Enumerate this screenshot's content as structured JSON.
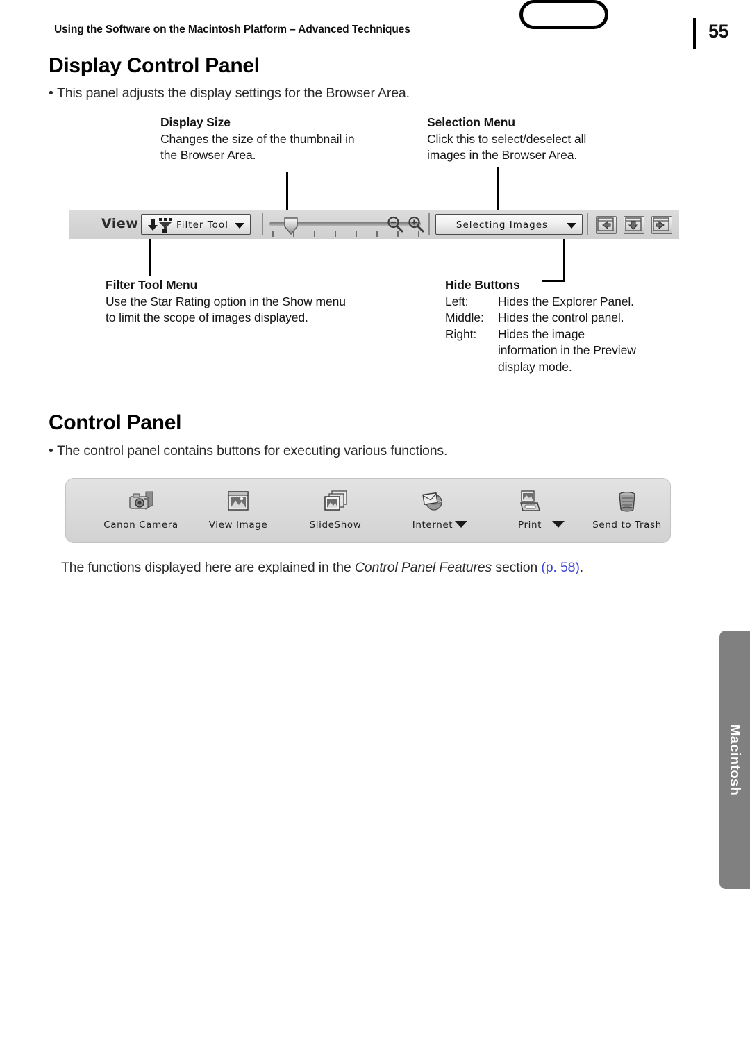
{
  "header": {
    "running_head": "Using the Software on the Macintosh Platform – Advanced Techniques",
    "page_number": "55"
  },
  "sections": [
    {
      "heading": "Display Control Panel",
      "bullet": "This panel adjusts the display settings for the Browser Area."
    },
    {
      "heading": "Control Panel",
      "bullet": "The control panel contains buttons for executing various functions."
    }
  ],
  "callouts": {
    "display_size": {
      "title": "Display Size",
      "lines": [
        "Changes the size of the thumbnail in",
        "the Browser Area."
      ]
    },
    "selection_menu": {
      "title": "Selection Menu",
      "lines": [
        "Click this to select/deselect all",
        "images in the Browser Area."
      ]
    },
    "filter_tool_menu": {
      "title": "Filter Tool Menu",
      "lines": [
        "Use the Star Rating option in the Show menu",
        "to limit the scope of images displayed."
      ]
    },
    "hide_buttons": {
      "title": "Hide Buttons",
      "rows": [
        {
          "key": "Left:",
          "value": "Hides the Explorer Panel."
        },
        {
          "key": "Middle:",
          "value": "Hides the control panel."
        },
        {
          "key": "Right:",
          "value": "Hides the image"
        }
      ],
      "continuation": [
        "information in the Preview",
        "display mode."
      ]
    }
  },
  "display_toolbar": {
    "view_label": "View",
    "filter_tool_value": "Filter Tool",
    "selection_value": "Selecting Images",
    "slider_tick_count": 8,
    "zoom_out_icon": "magnifier-minus-icon",
    "zoom_in_icon": "magnifier-plus-icon",
    "hide_buttons": [
      {
        "name": "hide-left-button",
        "icon": "panel-left-arrow-icon"
      },
      {
        "name": "hide-middle-button",
        "icon": "panel-down-arrow-icon"
      },
      {
        "name": "hide-right-button",
        "icon": "panel-right-arrow-icon"
      }
    ]
  },
  "control_panel": {
    "items": [
      {
        "label": "Canon Camera",
        "icon": "camera-icon",
        "caret": false
      },
      {
        "label": "View Image",
        "icon": "picture-window-icon",
        "caret": false
      },
      {
        "label": "SlideShow",
        "icon": "slideshow-stack-icon",
        "caret": false
      },
      {
        "label": "Internet",
        "icon": "globe-mail-icon",
        "caret": true
      },
      {
        "label": "Print",
        "icon": "printer-icon",
        "caret": true
      },
      {
        "label": "Send to Trash",
        "icon": "trash-can-icon",
        "caret": false
      }
    ]
  },
  "closing": {
    "part1": "The functions displayed here are explained in the ",
    "italic": "Control Panel Features",
    "part2": " section ",
    "page_ref": "(p. 58)",
    "part3": "."
  },
  "side_tab": {
    "label": "Macintosh",
    "color": "#808080"
  },
  "colors": {
    "toolbar_bg": "#d5d5d5",
    "panel_bg": "#dcdcdc",
    "link_blue": "#3a43d8",
    "ink": "#1a1a1a"
  }
}
